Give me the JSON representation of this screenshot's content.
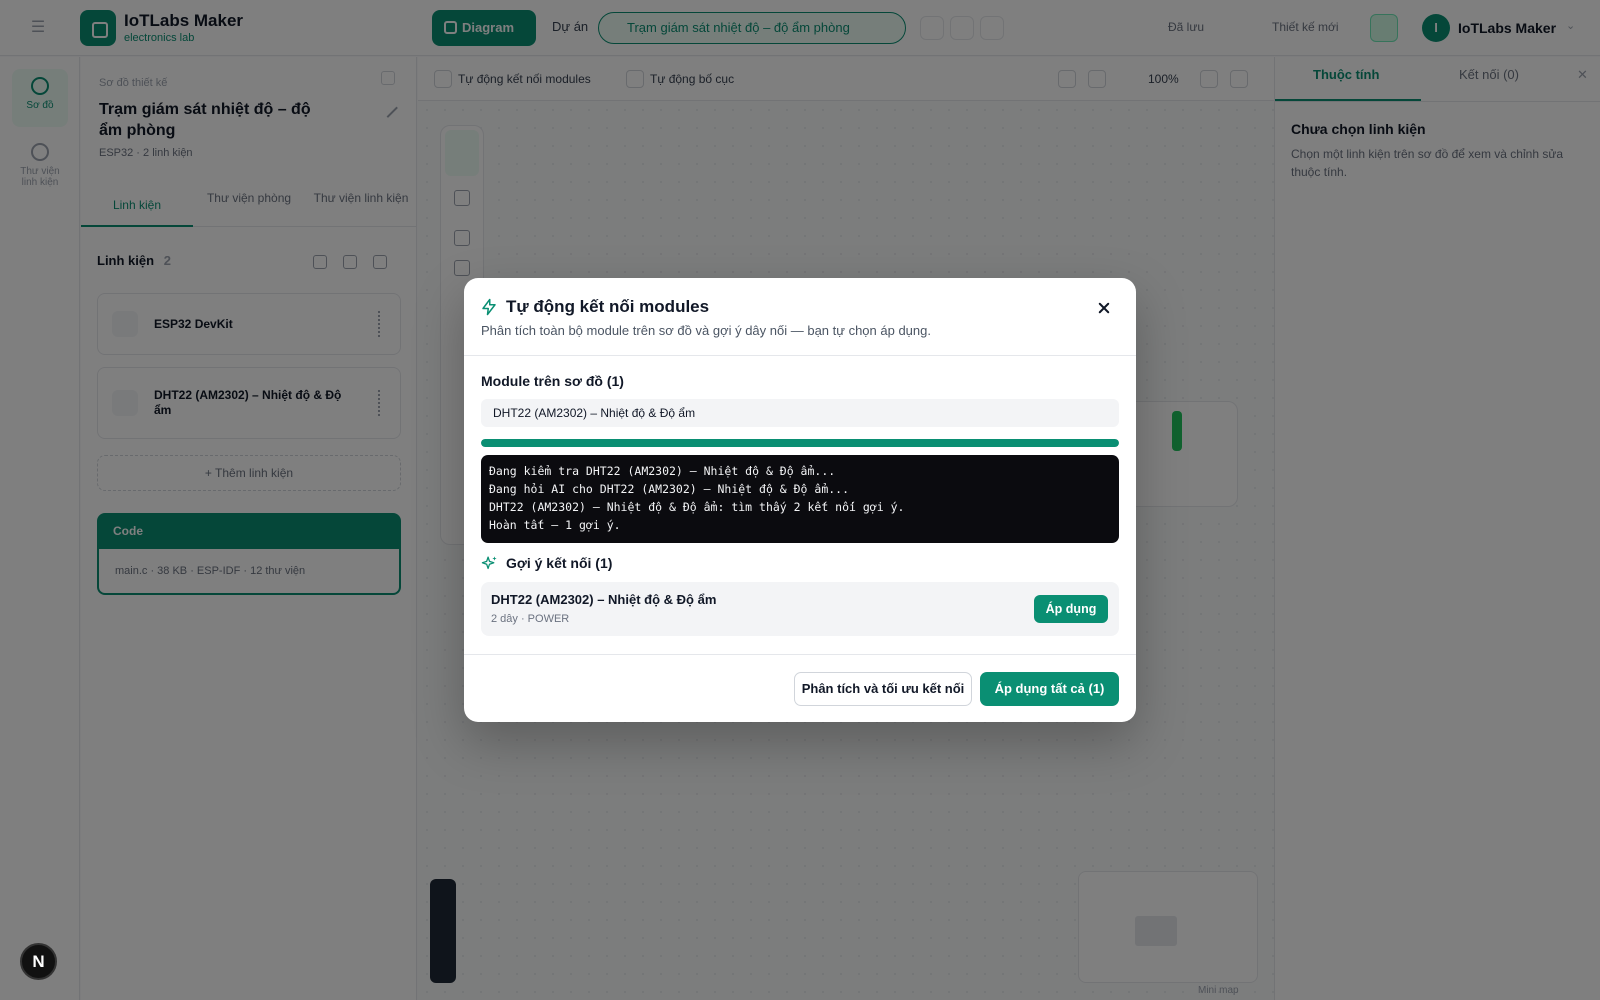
{
  "colors": {
    "accent": "#0a8f73",
    "overlay": "rgba(0,0,0,0.5)",
    "log_bg": "#0b0b0f"
  },
  "background": {
    "brand": {
      "name": "IoTLabs Maker",
      "subtitle": "electronics lab"
    },
    "toolbar": {
      "diagram_button": "Diagram",
      "project_label": "Dự án",
      "project_name": "Trạm giám sát nhiệt độ – độ ẩm phòng",
      "save_status": "Đã lưu",
      "new_design": "Thiết kế mới",
      "user_initial": "I",
      "user_name": "IoTLabs Maker"
    },
    "rail": [
      {
        "label": "Sơ đồ",
        "icon": "diagram-icon",
        "active": true
      },
      {
        "label": "Thư viện linh kiện",
        "icon": "library-icon",
        "active": false
      }
    ],
    "left_panel": {
      "crumb": "Sơ đồ thiết kế",
      "title": "Trạm giám sát nhiệt độ – độ ẩm phòng",
      "meta": "ESP32 · 2 linh kiện",
      "tabs": [
        "Linh kiện",
        "Thư viện phòng",
        "Thư viện linh kiện"
      ],
      "section_title": "Linh kiện",
      "section_count": "2",
      "components": [
        "ESP32 DevKit",
        "DHT22 (AM2302) – Nhiệt độ & Độ ẩm"
      ],
      "add_component": "+ Thêm linh kiện",
      "code_header": "Code",
      "code_meta": "main.c · 38 KB · ESP-IDF · 12 thư viện"
    },
    "canvas_toolbar": {
      "auto_connect": "Tự động kết nối modules",
      "auto_layout": "Tự động bố cục",
      "zoom": "100%"
    },
    "minimap_label": "Mini map",
    "right_panel": {
      "tabs": [
        "Thuộc tính",
        "Kết nối (0)"
      ],
      "title": "Chưa chọn linh kiện",
      "description": "Chọn một linh kiện trên sơ đồ để xem và chỉnh sửa thuộc tính."
    },
    "next_badge": "N"
  },
  "modal": {
    "title": "Tự động kết nối modules",
    "subtitle": "Phân tích toàn bộ module trên sơ đồ và gợi ý dây nối — bạn tự chọn áp dụng.",
    "modules_heading": "Module trên sơ đồ (1)",
    "modules": [
      "DHT22 (AM2302) – Nhiệt độ & Độ ẩm"
    ],
    "progress": 1.0,
    "log": [
      "Đang kiểm tra DHT22 (AM2302) – Nhiệt độ & Độ ẩm...",
      "Đang hỏi AI cho DHT22 (AM2302) – Nhiệt độ & Độ ẩm...",
      "DHT22 (AM2302) – Nhiệt độ & Độ ẩm: tìm thấy 2 kết nối gợi ý.",
      "Hoàn tất – 1 gợi ý."
    ],
    "suggestions_heading": "Gợi ý kết nối (1)",
    "suggestions": [
      {
        "name": "DHT22 (AM2302) – Nhiệt độ & Độ ẩm",
        "meta": "2 dây · POWER",
        "apply_label": "Áp dụng"
      }
    ],
    "analyze_button": "Phân tích và tối ưu kết nối",
    "apply_all_button": "Áp dụng tất cả (1)"
  }
}
